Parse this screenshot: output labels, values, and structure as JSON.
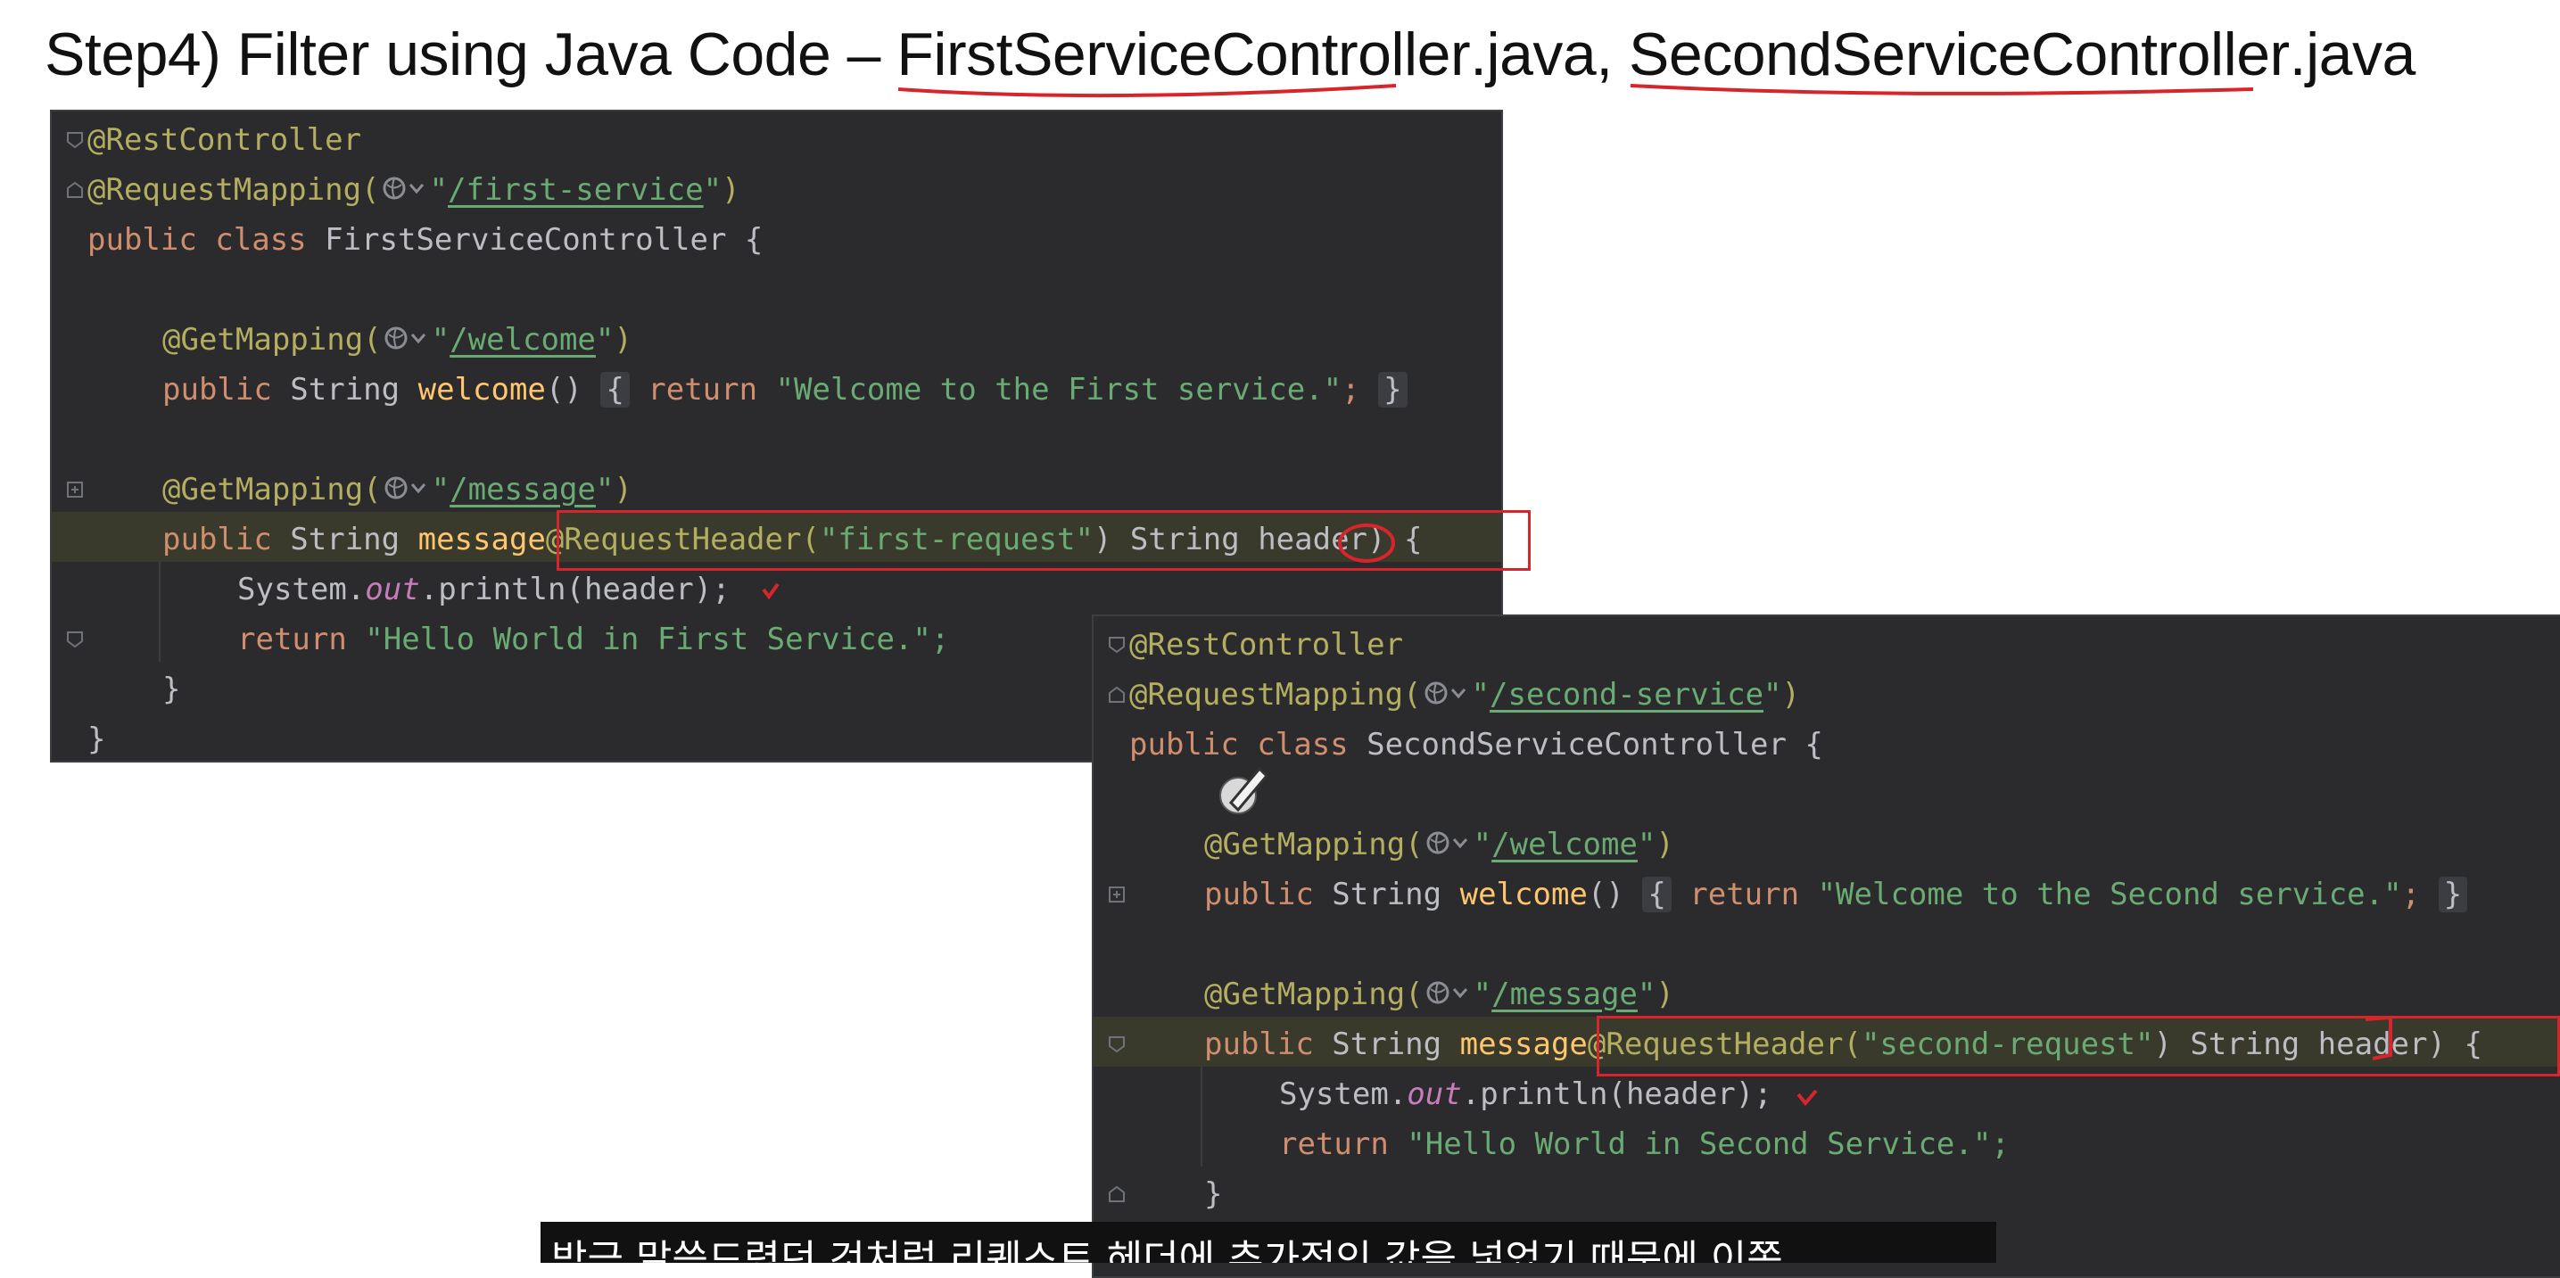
{
  "slide": {
    "title_prefix": "Step4) Filter using Java Code – ",
    "file1_name": "FirstServiceController",
    "file1_ext": ".java, ",
    "file2_name": "SecondServiceController",
    "file2_ext": ".java",
    "accent_color": "#d6252b"
  },
  "first_editor": {
    "annotation_rest": "@RestController",
    "annotation_mapping": "@RequestMapping(",
    "mapping_path": "/first-service",
    "class_kw": "public class ",
    "class_name": "FirstServiceController {",
    "welcome_annotation": "@GetMapping(",
    "welcome_path": "/welcome",
    "public_kw": "public",
    "string_type": " String ",
    "welcome_method": "welcome",
    "welcome_parens": "() ",
    "welcome_open_brace": "{",
    "return_kw": " return ",
    "welcome_return": "\"Welcome to the First service.\"",
    "semicolon": ";",
    "welcome_close_brace": "}",
    "message_annotation": "@GetMapping(",
    "message_path": "/message",
    "message_method": "message",
    "request_header_annotation": "@RequestHeader(",
    "header_key": "\"first-request\"",
    "header_param": ") String header) {",
    "system_out": "System.",
    "out_field": "out",
    "println_call": ".println(header);",
    "return_kw2": "return ",
    "hello_return": "\"Hello World in First Service.\";",
    "inner_close": "}",
    "outer_close": "}"
  },
  "second_editor": {
    "annotation_rest": "@RestController",
    "annotation_mapping": "@RequestMapping(",
    "mapping_path": "/second-service",
    "class_kw": "public class ",
    "class_name": "SecondServiceController {",
    "welcome_annotation": "@GetMapping(",
    "welcome_path": "/welcome",
    "public_kw": "public",
    "string_type": " String ",
    "welcome_method": "welcome",
    "welcome_parens": "() ",
    "welcome_open_brace": "{",
    "return_kw": " return ",
    "welcome_return": "\"Welcome to the Second service.\"",
    "semicolon": ";",
    "welcome_close_brace": "}",
    "message_annotation": "@GetMapping(",
    "message_path": "/message",
    "message_method": "message",
    "request_header_annotation": "@RequestHeader(",
    "header_key": "\"second-request\"",
    "header_param": ") String header) {",
    "system_out": "System.",
    "out_field": "out",
    "println_call": ".println(header);",
    "return_kw2": "return ",
    "hello_return": "\"Hello World in Second Service.\";",
    "inner_close": "}"
  },
  "caption": {
    "text": "방금 말씀드렸던 것처럼 리퀘스트 헤더에 추가적인 값을 넣었기 때문에 이쪽"
  }
}
